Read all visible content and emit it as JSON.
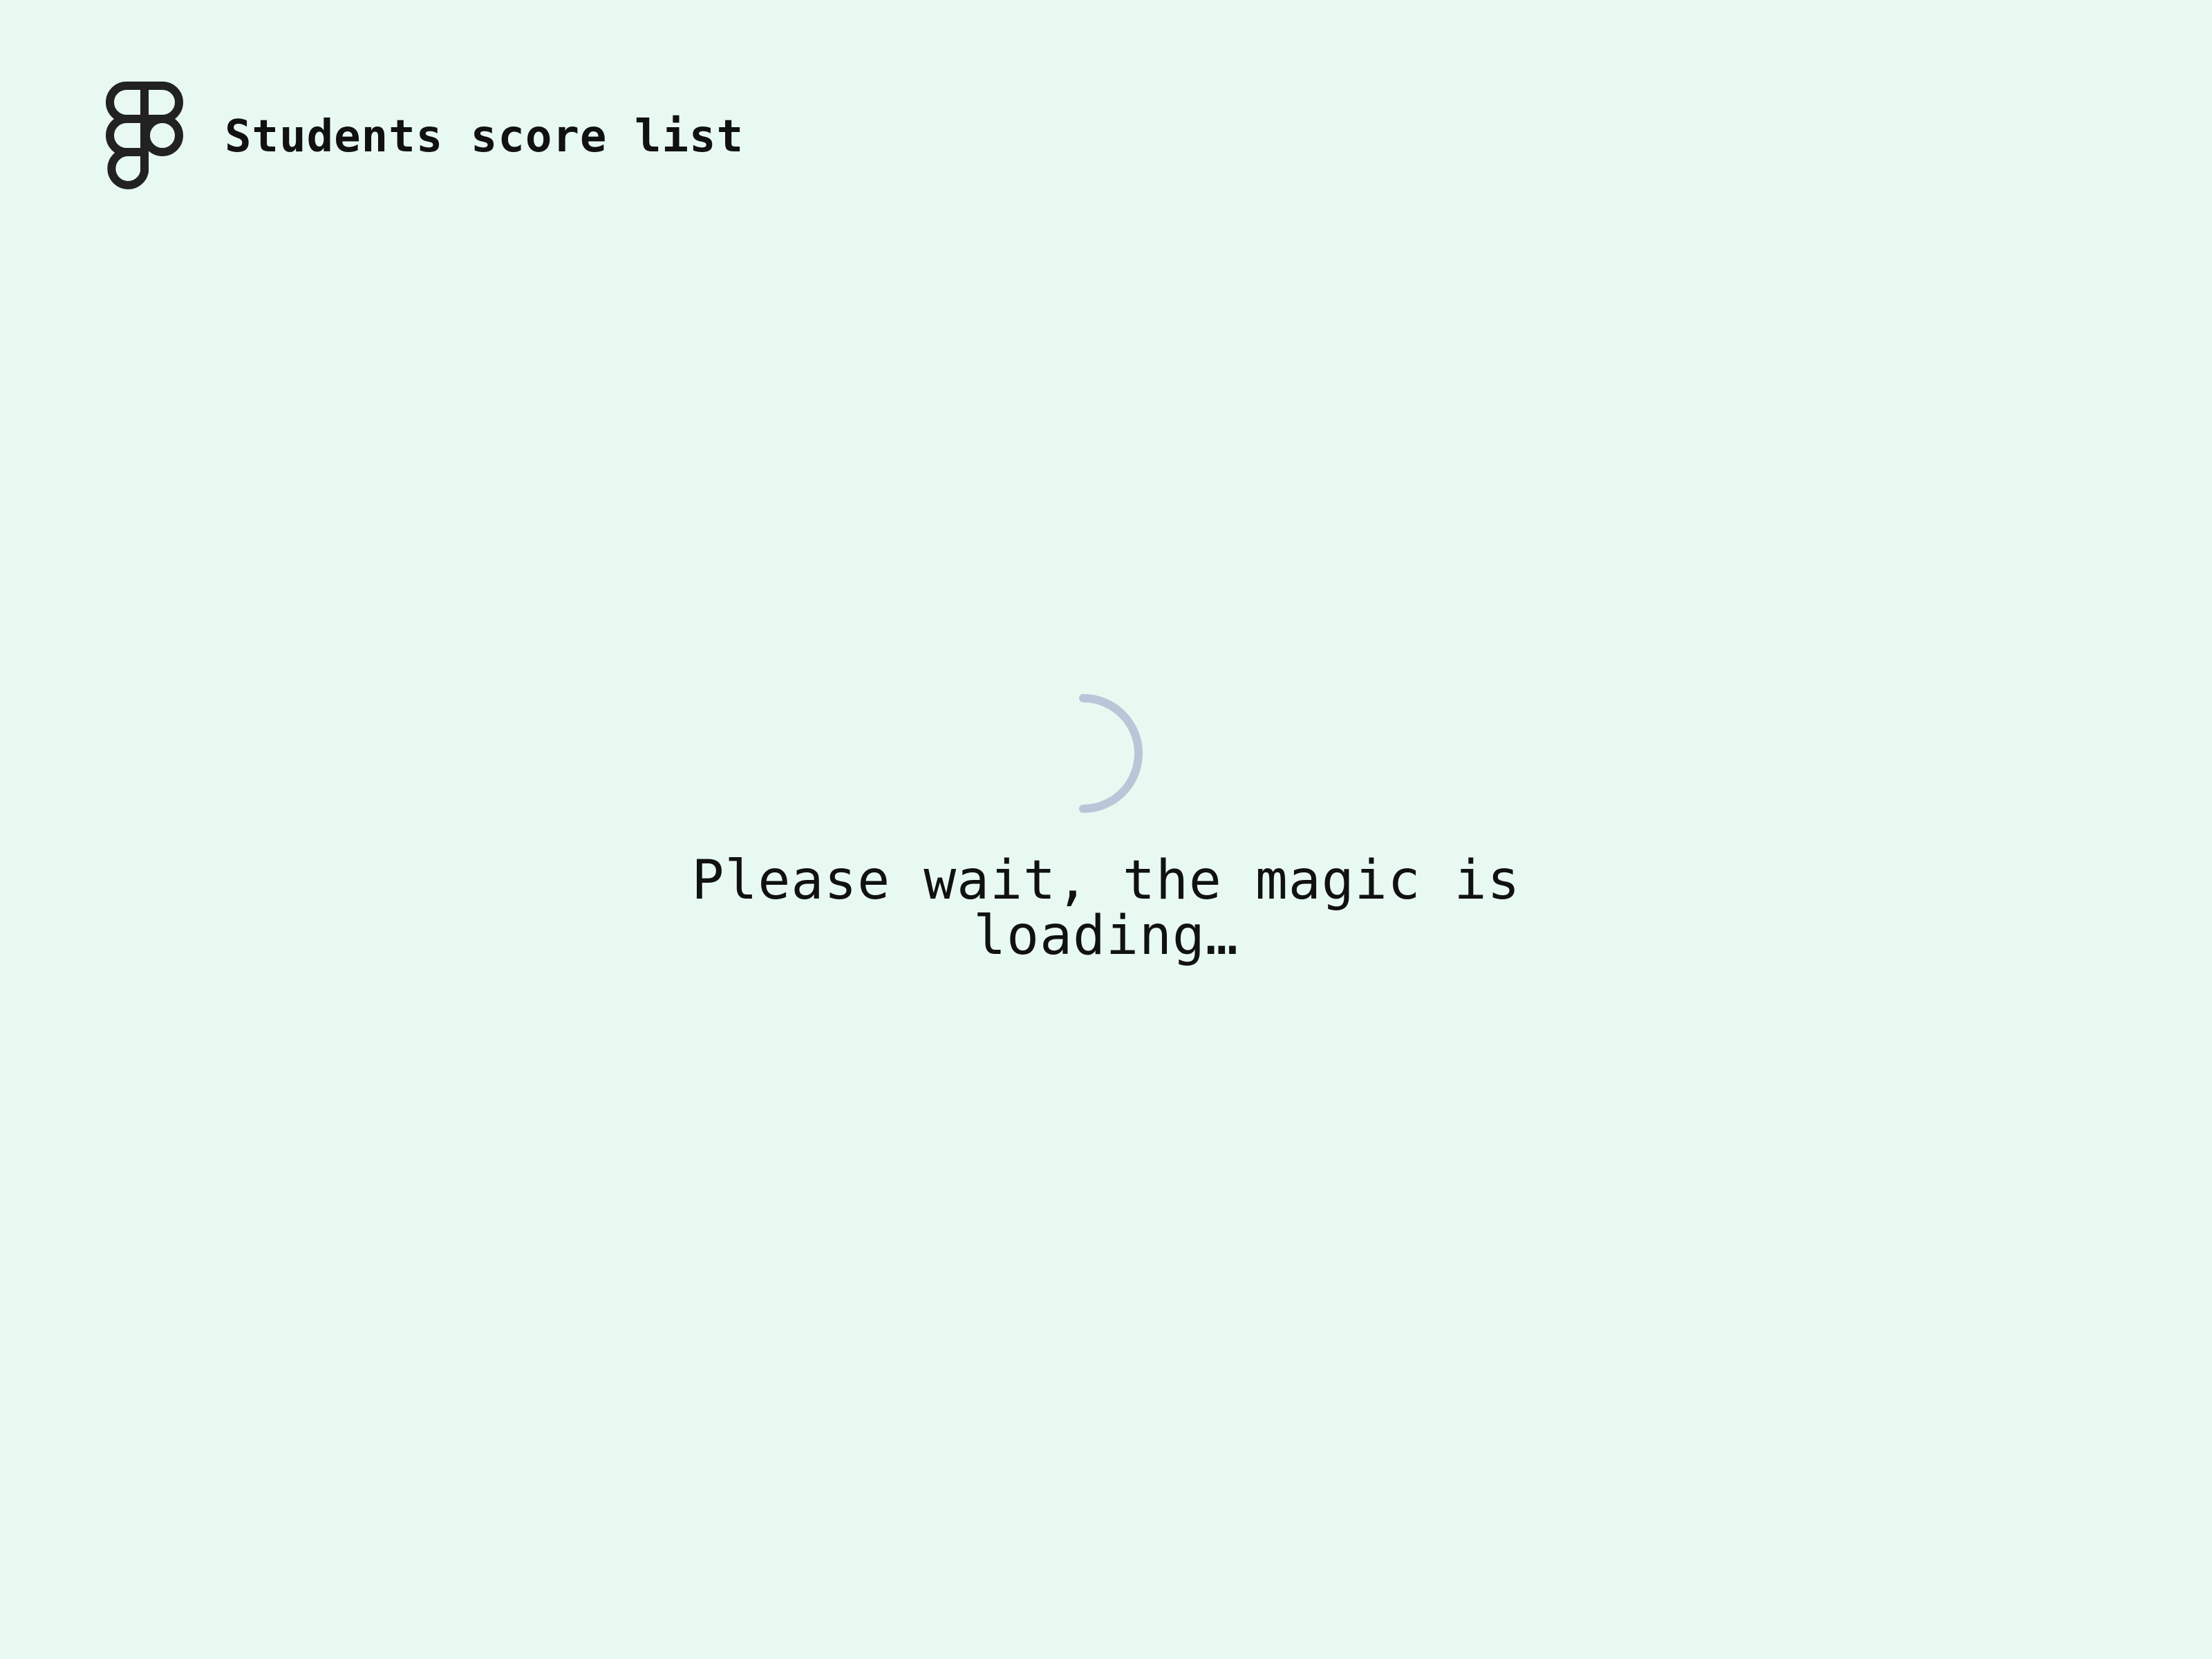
{
  "header": {
    "logo_icon": "figma-logo-icon",
    "title": "Students score list"
  },
  "loader": {
    "spinner_icon": "loading-spinner-icon",
    "spinner_color": "#b9c6d8",
    "message": "Please wait, the magic is loading…"
  },
  "theme": {
    "background": "#e8f9f2",
    "text": "#111111",
    "logo": "#222222"
  }
}
